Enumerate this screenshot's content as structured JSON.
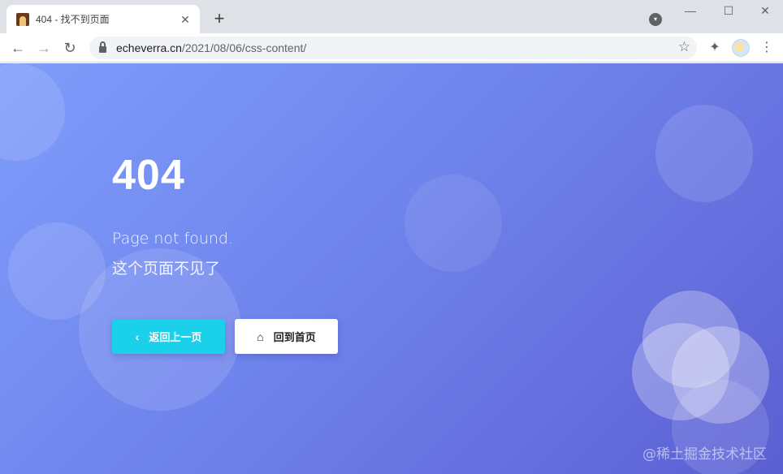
{
  "browser": {
    "tab_title": "404 - 找不到页面",
    "tab_close": "✕",
    "new_tab": "+",
    "url_host": "echeverra.cn",
    "url_path": "/2021/08/06/css-content/",
    "window_controls": {
      "minimize": "—",
      "maximize": "☐",
      "close": "✕"
    },
    "icons": {
      "back": "←",
      "forward": "→",
      "reload": "↻",
      "star": "☆",
      "extensions": "✦",
      "menu": "⋮",
      "profile_menu": "▾"
    }
  },
  "page": {
    "error_code": "404",
    "message_en": "Page not found.",
    "message_zh": "这个页面不见了",
    "buttons": {
      "back": {
        "icon": "‹",
        "label": "返回上一页"
      },
      "home": {
        "icon": "⌂",
        "label": "回到首页"
      }
    },
    "watermark": "@稀土掘金技术社区",
    "colors": {
      "gradient_start": "#7f9dfb",
      "gradient_end": "#5b5fd2",
      "back_button": "#1ad0ea",
      "home_button": "#ffffff"
    }
  }
}
